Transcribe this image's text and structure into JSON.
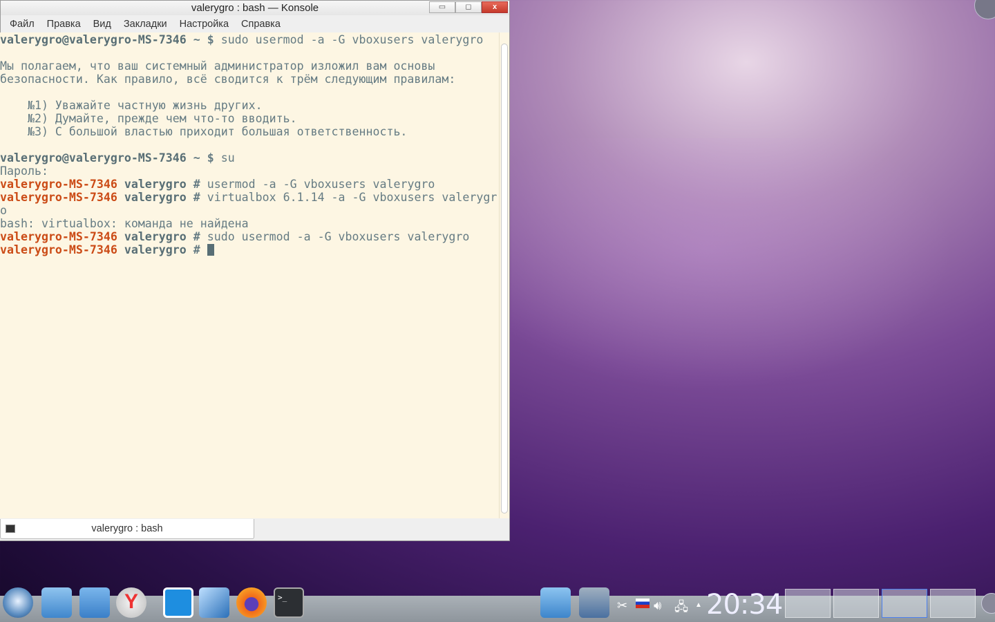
{
  "window": {
    "title": "valerygro : bash — Konsole",
    "minimize": "▭",
    "maximize": "◻",
    "close": "x"
  },
  "menu": [
    "Файл",
    "Правка",
    "Вид",
    "Закладки",
    "Настройка",
    "Справка"
  ],
  "terminal": {
    "user_prompt": "valerygro@valerygro-MS-7346",
    "prompt_suffix": " ~ $ ",
    "cmd1": "sudo usermod -a -G vboxusers valerygro",
    "lecture1": "Мы полагаем, что ваш системный администратор изложил вам основы",
    "lecture2": "безопасности. Как правило, всё сводится к трём следующим правилам:",
    "rule1": "    №1) Уважайте частную жизнь других.",
    "rule2": "    №2) Думайте, прежде чем что-то вводить.",
    "rule3": "    №3) С большой властью приходит большая ответственность.",
    "cmd2": "su",
    "password": "Пароль:",
    "root_host": "valerygro-MS-7346",
    "root_dir": " valerygro",
    "root_suffix": " # ",
    "cmd3": "usermod -a -G vboxusers valerygro",
    "cmd4a": "virtualbox 6.1.14 -a -G vboxusers valerygr",
    "cmd4b": "o",
    "error": "bash: virtualbox: команда не найдена",
    "cmd5": "sudo usermod -a -G vboxusers valerygro"
  },
  "tab": {
    "label": "valerygro : bash"
  },
  "taskbar": {
    "clock": "20:34",
    "pager_count": 4,
    "colors": {
      "prompt_red": "#cb4b16",
      "bg": "#fdf6e3"
    }
  }
}
